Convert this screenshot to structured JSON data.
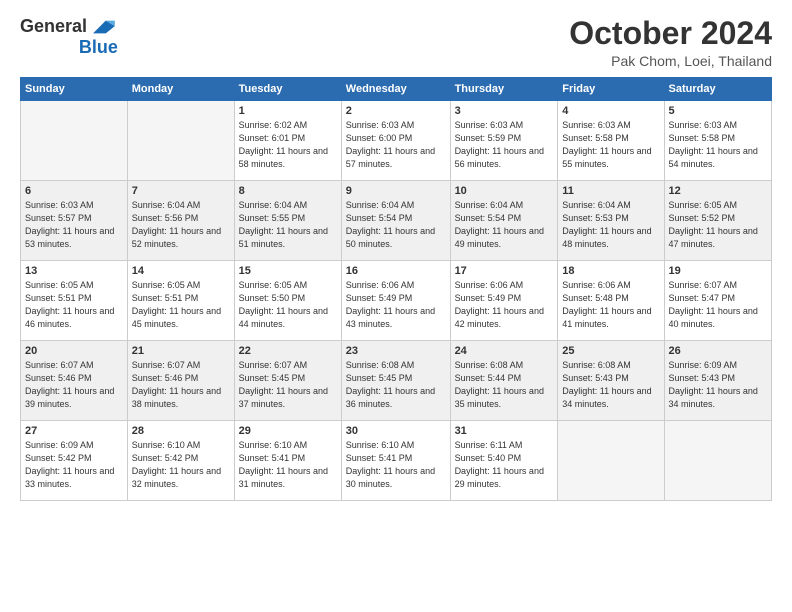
{
  "header": {
    "logo_general": "General",
    "logo_blue": "Blue",
    "month_title": "October 2024",
    "subtitle": "Pak Chom, Loei, Thailand"
  },
  "weekdays": [
    "Sunday",
    "Monday",
    "Tuesday",
    "Wednesday",
    "Thursday",
    "Friday",
    "Saturday"
  ],
  "weeks": [
    [
      {
        "day": "",
        "info": ""
      },
      {
        "day": "",
        "info": ""
      },
      {
        "day": "1",
        "info": "Sunrise: 6:02 AM\nSunset: 6:01 PM\nDaylight: 11 hours and 58 minutes."
      },
      {
        "day": "2",
        "info": "Sunrise: 6:03 AM\nSunset: 6:00 PM\nDaylight: 11 hours and 57 minutes."
      },
      {
        "day": "3",
        "info": "Sunrise: 6:03 AM\nSunset: 5:59 PM\nDaylight: 11 hours and 56 minutes."
      },
      {
        "day": "4",
        "info": "Sunrise: 6:03 AM\nSunset: 5:58 PM\nDaylight: 11 hours and 55 minutes."
      },
      {
        "day": "5",
        "info": "Sunrise: 6:03 AM\nSunset: 5:58 PM\nDaylight: 11 hours and 54 minutes."
      }
    ],
    [
      {
        "day": "6",
        "info": "Sunrise: 6:03 AM\nSunset: 5:57 PM\nDaylight: 11 hours and 53 minutes."
      },
      {
        "day": "7",
        "info": "Sunrise: 6:04 AM\nSunset: 5:56 PM\nDaylight: 11 hours and 52 minutes."
      },
      {
        "day": "8",
        "info": "Sunrise: 6:04 AM\nSunset: 5:55 PM\nDaylight: 11 hours and 51 minutes."
      },
      {
        "day": "9",
        "info": "Sunrise: 6:04 AM\nSunset: 5:54 PM\nDaylight: 11 hours and 50 minutes."
      },
      {
        "day": "10",
        "info": "Sunrise: 6:04 AM\nSunset: 5:54 PM\nDaylight: 11 hours and 49 minutes."
      },
      {
        "day": "11",
        "info": "Sunrise: 6:04 AM\nSunset: 5:53 PM\nDaylight: 11 hours and 48 minutes."
      },
      {
        "day": "12",
        "info": "Sunrise: 6:05 AM\nSunset: 5:52 PM\nDaylight: 11 hours and 47 minutes."
      }
    ],
    [
      {
        "day": "13",
        "info": "Sunrise: 6:05 AM\nSunset: 5:51 PM\nDaylight: 11 hours and 46 minutes."
      },
      {
        "day": "14",
        "info": "Sunrise: 6:05 AM\nSunset: 5:51 PM\nDaylight: 11 hours and 45 minutes."
      },
      {
        "day": "15",
        "info": "Sunrise: 6:05 AM\nSunset: 5:50 PM\nDaylight: 11 hours and 44 minutes."
      },
      {
        "day": "16",
        "info": "Sunrise: 6:06 AM\nSunset: 5:49 PM\nDaylight: 11 hours and 43 minutes."
      },
      {
        "day": "17",
        "info": "Sunrise: 6:06 AM\nSunset: 5:49 PM\nDaylight: 11 hours and 42 minutes."
      },
      {
        "day": "18",
        "info": "Sunrise: 6:06 AM\nSunset: 5:48 PM\nDaylight: 11 hours and 41 minutes."
      },
      {
        "day": "19",
        "info": "Sunrise: 6:07 AM\nSunset: 5:47 PM\nDaylight: 11 hours and 40 minutes."
      }
    ],
    [
      {
        "day": "20",
        "info": "Sunrise: 6:07 AM\nSunset: 5:46 PM\nDaylight: 11 hours and 39 minutes."
      },
      {
        "day": "21",
        "info": "Sunrise: 6:07 AM\nSunset: 5:46 PM\nDaylight: 11 hours and 38 minutes."
      },
      {
        "day": "22",
        "info": "Sunrise: 6:07 AM\nSunset: 5:45 PM\nDaylight: 11 hours and 37 minutes."
      },
      {
        "day": "23",
        "info": "Sunrise: 6:08 AM\nSunset: 5:45 PM\nDaylight: 11 hours and 36 minutes."
      },
      {
        "day": "24",
        "info": "Sunrise: 6:08 AM\nSunset: 5:44 PM\nDaylight: 11 hours and 35 minutes."
      },
      {
        "day": "25",
        "info": "Sunrise: 6:08 AM\nSunset: 5:43 PM\nDaylight: 11 hours and 34 minutes."
      },
      {
        "day": "26",
        "info": "Sunrise: 6:09 AM\nSunset: 5:43 PM\nDaylight: 11 hours and 34 minutes."
      }
    ],
    [
      {
        "day": "27",
        "info": "Sunrise: 6:09 AM\nSunset: 5:42 PM\nDaylight: 11 hours and 33 minutes."
      },
      {
        "day": "28",
        "info": "Sunrise: 6:10 AM\nSunset: 5:42 PM\nDaylight: 11 hours and 32 minutes."
      },
      {
        "day": "29",
        "info": "Sunrise: 6:10 AM\nSunset: 5:41 PM\nDaylight: 11 hours and 31 minutes."
      },
      {
        "day": "30",
        "info": "Sunrise: 6:10 AM\nSunset: 5:41 PM\nDaylight: 11 hours and 30 minutes."
      },
      {
        "day": "31",
        "info": "Sunrise: 6:11 AM\nSunset: 5:40 PM\nDaylight: 11 hours and 29 minutes."
      },
      {
        "day": "",
        "info": ""
      },
      {
        "day": "",
        "info": ""
      }
    ]
  ]
}
